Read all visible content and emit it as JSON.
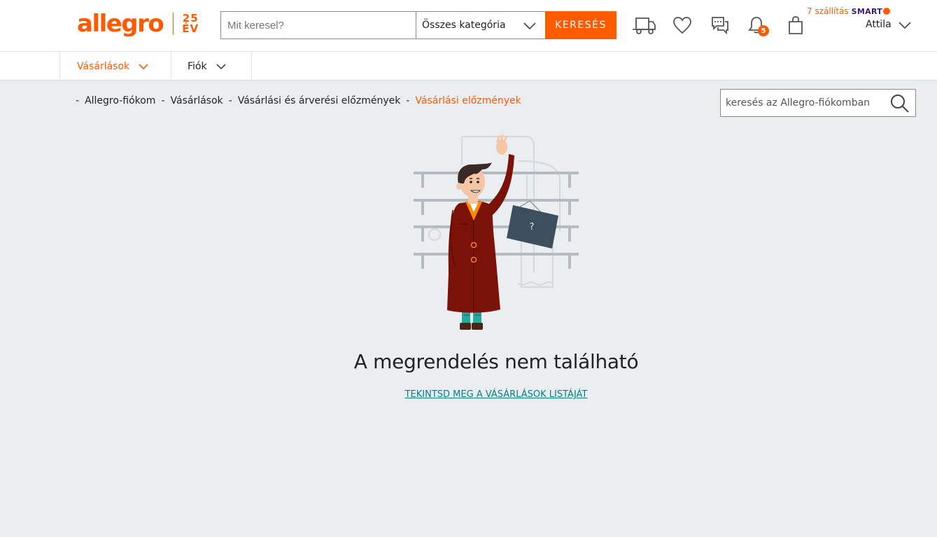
{
  "header": {
    "logo_text": "allegro",
    "logo_badge_top": "25",
    "logo_badge_bottom": "ÉV",
    "search_placeholder": "Mit keresel?",
    "category_selected": "Összes kategória",
    "search_button": "KERESÉS",
    "icons": [
      "delivery-truck-icon",
      "heart-icon",
      "messages-icon",
      "bell-icon",
      "shopping-bag-icon"
    ],
    "notification_count": "5",
    "smart_text": "7 szállítás",
    "smart_brand": "SMART",
    "user_name": "Attila"
  },
  "subnav": {
    "tabs": [
      {
        "label": "Vásárlások"
      },
      {
        "label": "Fiók"
      }
    ]
  },
  "breadcrumb": {
    "separator": "-",
    "items": [
      "Allegro-fiókom",
      "Vásárlások",
      "Vásárlási és árverési előzmények",
      "Vásárlási előzmények"
    ]
  },
  "account_search": {
    "placeholder": "keresés az Allegro-fiókomban"
  },
  "illustration": {
    "sign_text": "?"
  },
  "main": {
    "title": "A megrendelés nem található",
    "link": "TEKINTSD MEG A VÁSÁRLÁSOK LISTÁJÁT"
  },
  "colors": {
    "brand": "#ff5a00",
    "link": "#00808a",
    "background": "#ebeef1",
    "smart": "#3b1d6b"
  }
}
